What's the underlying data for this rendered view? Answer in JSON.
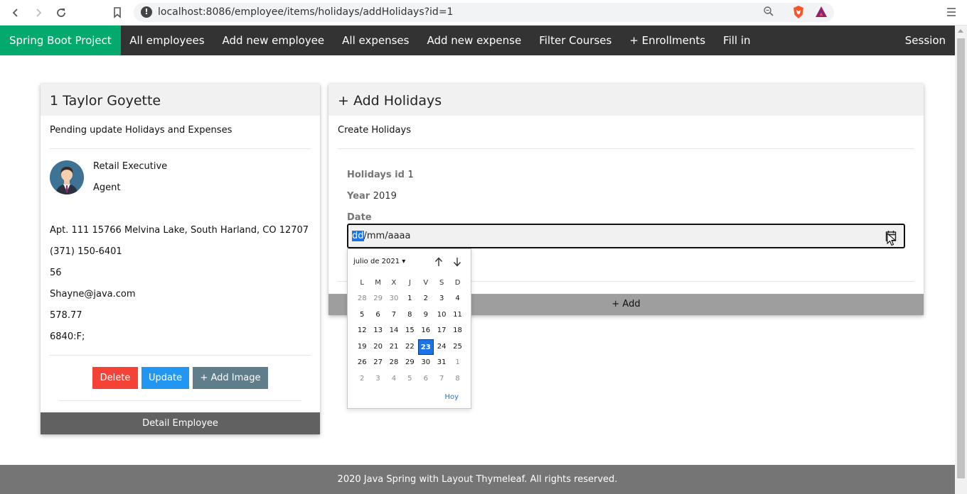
{
  "browser": {
    "url": "localhost:8086/employee/items/holidays/addHolidays?id=1"
  },
  "navbar": {
    "brand": "Spring Boot Project",
    "items": [
      "All employees",
      "Add new employee",
      "All expenses",
      "Add new expense",
      "Filter Courses",
      "+ Enrollments",
      "Fill in"
    ],
    "session": "Session"
  },
  "employee": {
    "title": "1 Taylor Goyette",
    "subtitle": "Pending update Holidays and Expenses",
    "role": "Retail Executive",
    "job": "Agent",
    "address": "Apt. 111 15766 Melvina Lake, South Harland, CO 12707",
    "phone": "(371) 150-6401",
    "age": "56",
    "email": "Shayne@java.com",
    "salary": "578.77",
    "code": "6840:F;",
    "delete_label": "Delete",
    "update_label": "Update",
    "add_image_label": "+ Add Image",
    "footer_label": "Detail Employee"
  },
  "holidays": {
    "title": "+ Add Holidays",
    "subtitle": "Create Holidays",
    "id_label": "Holidays id",
    "id_value": "1",
    "year_label": "Year",
    "year_value": "2019",
    "date_label": "Date",
    "date_day": "dd",
    "date_rest": "/mm/aaaa",
    "add_label": "+ Add"
  },
  "calendar": {
    "month_label": "julio de 2021 ▾",
    "weekdays": [
      "L",
      "M",
      "X",
      "J",
      "V",
      "S",
      "D"
    ],
    "days": [
      {
        "d": "28",
        "dim": true
      },
      {
        "d": "29",
        "dim": true
      },
      {
        "d": "30",
        "dim": true
      },
      {
        "d": "1"
      },
      {
        "d": "2"
      },
      {
        "d": "3"
      },
      {
        "d": "4"
      },
      {
        "d": "5"
      },
      {
        "d": "6"
      },
      {
        "d": "7"
      },
      {
        "d": "8"
      },
      {
        "d": "9"
      },
      {
        "d": "10"
      },
      {
        "d": "11"
      },
      {
        "d": "12"
      },
      {
        "d": "13"
      },
      {
        "d": "14"
      },
      {
        "d": "15"
      },
      {
        "d": "16"
      },
      {
        "d": "17"
      },
      {
        "d": "18"
      },
      {
        "d": "19"
      },
      {
        "d": "20"
      },
      {
        "d": "21"
      },
      {
        "d": "22"
      },
      {
        "d": "23",
        "today": true
      },
      {
        "d": "24"
      },
      {
        "d": "25"
      },
      {
        "d": "26"
      },
      {
        "d": "27"
      },
      {
        "d": "28"
      },
      {
        "d": "29"
      },
      {
        "d": "30"
      },
      {
        "d": "31"
      },
      {
        "d": "1",
        "dim": true
      },
      {
        "d": "2",
        "dim": true
      },
      {
        "d": "3",
        "dim": true
      },
      {
        "d": "4",
        "dim": true
      },
      {
        "d": "5",
        "dim": true
      },
      {
        "d": "6",
        "dim": true
      },
      {
        "d": "7",
        "dim": true
      },
      {
        "d": "8",
        "dim": true
      }
    ],
    "today_label": "Hoy"
  },
  "footer": {
    "text": "2020 Java Spring with Layout Thymeleaf. All rights reserved."
  },
  "colors": {
    "brand": "#04aa6d",
    "navbar": "#333333",
    "delete": "#f44336",
    "update": "#2196f3",
    "image": "#607d8b",
    "selected_day": "#1a73e8"
  }
}
